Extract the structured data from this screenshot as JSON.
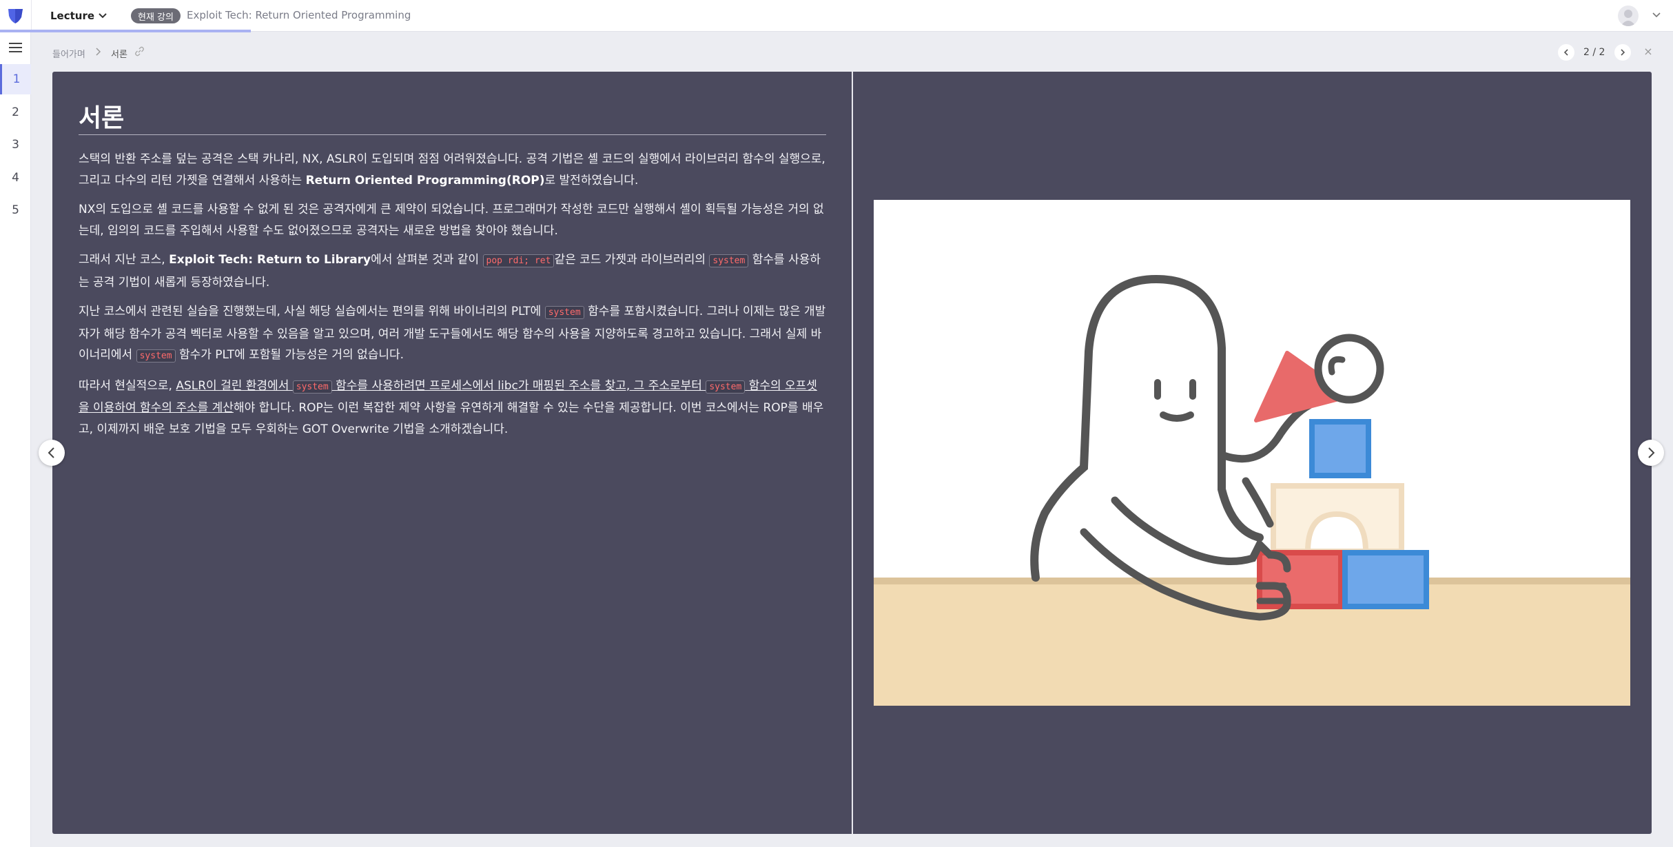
{
  "header": {
    "lecture_dropdown": "Lecture",
    "badge": "현재 강의",
    "course_title": "Exploit Tech: Return Oriented Programming",
    "colors": {
      "accent": "#5b6bdc",
      "progress": "#a9b2f2"
    }
  },
  "sidebar": {
    "items": [
      {
        "label": "1",
        "active": true
      },
      {
        "label": "2"
      },
      {
        "label": "3"
      },
      {
        "label": "4"
      },
      {
        "label": "5"
      }
    ]
  },
  "subheader": {
    "home": "들어가며",
    "current": "서론",
    "pager": "2 / 2"
  },
  "slide": {
    "title": "서론",
    "p1": {
      "a": "스택의 반환 주소를 덮는 공격은 스택 카나리, NX, ASLR이 도입되며 점점 어려워졌습니다. 공격 기법은 셸 코드의 실행에서 라이브러리 함수의 실행으로, 그리고 다수의 리턴 가젯을 연결해서 사용하는 ",
      "b": "Return Oriented Programming(ROP)",
      "c": "로 발전하였습니다."
    },
    "p2": "NX의 도입으로 셸 코드를 사용할 수 없게 된 것은 공격자에게 큰 제약이 되었습니다. 프로그래머가 작성한 코드만 실행해서 셸이 획득될 가능성은 거의 없는데, 임의의 코드를 주입해서 사용할 수도 없어졌으므로 공격자는 새로운 방법을 찾아야 했습니다.",
    "p3": {
      "a": "그래서 지난 코스, ",
      "b": "Exploit Tech: Return to Library",
      "c": "에서 살펴본 것과 같이 ",
      "code1": "pop rdi; ret",
      "d": "같은 코드 가젯과 라이브러리의 ",
      "code2": "system",
      "e": " 함수를 사용하는 공격 기법이 새롭게 등장하였습니다."
    },
    "p4": {
      "a": "지난 코스에서 관련된 실습을 진행했는데, 사실 해당 실습에서는 편의를 위해 바이너리의 PLT에 ",
      "code1": "system",
      "b": " 함수를 포함시켰습니다. 그러나 이제는 많은 개발자가 해당 함수가 공격 벡터로 사용할 수 있음을 알고 있으며, 여러 개발 도구들에서도 해당 함수의 사용을 지양하도록 경고하고 있습니다. 그래서 실제 바이너리에서 ",
      "code2": "system",
      "c": " 함수가 PLT에 포함될 가능성은 거의 없습니다."
    },
    "p5": {
      "a": "따라서 현실적으로, ",
      "u1": "ASLR이 걸린 환경에서 ",
      "code1": "system",
      "u2": " 함수를 사용하려면 프로세스에서 libc가 매핑된 주소를 찾고, 그 주소로부터 ",
      "code2": "system",
      "u3": " 함수의 오프셋을 이용하여 함수의 주소를 계산",
      "b": "해야 합니다. ROP는 이런 복잡한 제약 사항을 유연하게 해결할 수 있는 수단을 제공합니다. 이번 코스에서는 ROP를 배우고, 이제까지 배운 보호 기법을 모두 우회하는 GOT Overwrite 기법을 소개하겠습니다."
    }
  }
}
